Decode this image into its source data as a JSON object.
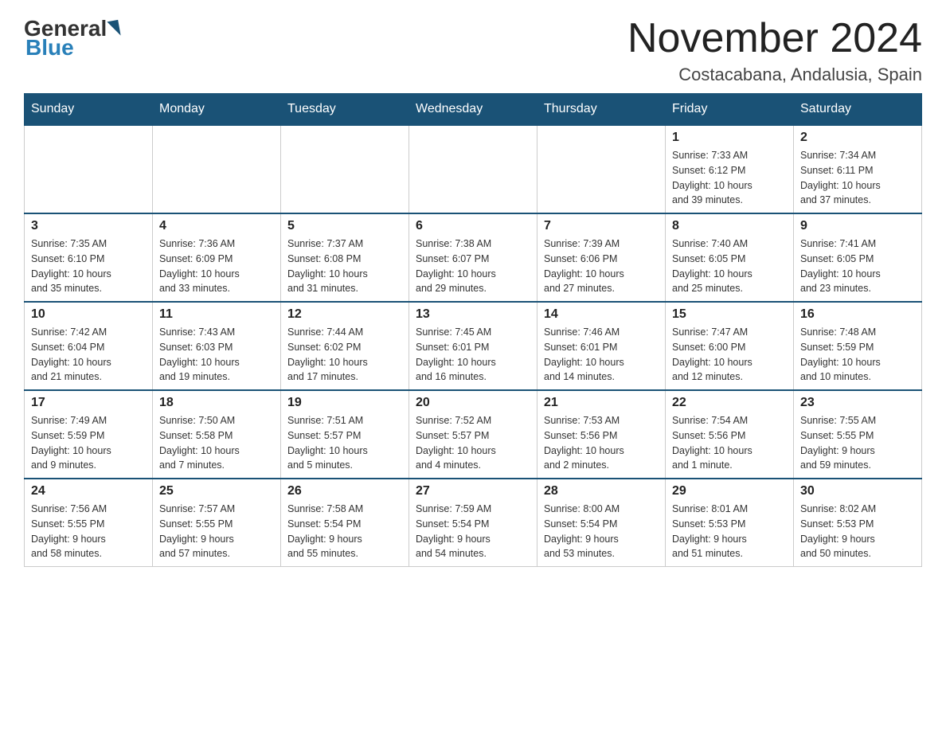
{
  "header": {
    "logo_general": "General",
    "logo_blue": "Blue",
    "title": "November 2024",
    "subtitle": "Costacabana, Andalusia, Spain"
  },
  "days_of_week": [
    "Sunday",
    "Monday",
    "Tuesday",
    "Wednesday",
    "Thursday",
    "Friday",
    "Saturday"
  ],
  "weeks": [
    {
      "days": [
        {
          "num": "",
          "info": ""
        },
        {
          "num": "",
          "info": ""
        },
        {
          "num": "",
          "info": ""
        },
        {
          "num": "",
          "info": ""
        },
        {
          "num": "",
          "info": ""
        },
        {
          "num": "1",
          "info": "Sunrise: 7:33 AM\nSunset: 6:12 PM\nDaylight: 10 hours\nand 39 minutes."
        },
        {
          "num": "2",
          "info": "Sunrise: 7:34 AM\nSunset: 6:11 PM\nDaylight: 10 hours\nand 37 minutes."
        }
      ]
    },
    {
      "days": [
        {
          "num": "3",
          "info": "Sunrise: 7:35 AM\nSunset: 6:10 PM\nDaylight: 10 hours\nand 35 minutes."
        },
        {
          "num": "4",
          "info": "Sunrise: 7:36 AM\nSunset: 6:09 PM\nDaylight: 10 hours\nand 33 minutes."
        },
        {
          "num": "5",
          "info": "Sunrise: 7:37 AM\nSunset: 6:08 PM\nDaylight: 10 hours\nand 31 minutes."
        },
        {
          "num": "6",
          "info": "Sunrise: 7:38 AM\nSunset: 6:07 PM\nDaylight: 10 hours\nand 29 minutes."
        },
        {
          "num": "7",
          "info": "Sunrise: 7:39 AM\nSunset: 6:06 PM\nDaylight: 10 hours\nand 27 minutes."
        },
        {
          "num": "8",
          "info": "Sunrise: 7:40 AM\nSunset: 6:05 PM\nDaylight: 10 hours\nand 25 minutes."
        },
        {
          "num": "9",
          "info": "Sunrise: 7:41 AM\nSunset: 6:05 PM\nDaylight: 10 hours\nand 23 minutes."
        }
      ]
    },
    {
      "days": [
        {
          "num": "10",
          "info": "Sunrise: 7:42 AM\nSunset: 6:04 PM\nDaylight: 10 hours\nand 21 minutes."
        },
        {
          "num": "11",
          "info": "Sunrise: 7:43 AM\nSunset: 6:03 PM\nDaylight: 10 hours\nand 19 minutes."
        },
        {
          "num": "12",
          "info": "Sunrise: 7:44 AM\nSunset: 6:02 PM\nDaylight: 10 hours\nand 17 minutes."
        },
        {
          "num": "13",
          "info": "Sunrise: 7:45 AM\nSunset: 6:01 PM\nDaylight: 10 hours\nand 16 minutes."
        },
        {
          "num": "14",
          "info": "Sunrise: 7:46 AM\nSunset: 6:01 PM\nDaylight: 10 hours\nand 14 minutes."
        },
        {
          "num": "15",
          "info": "Sunrise: 7:47 AM\nSunset: 6:00 PM\nDaylight: 10 hours\nand 12 minutes."
        },
        {
          "num": "16",
          "info": "Sunrise: 7:48 AM\nSunset: 5:59 PM\nDaylight: 10 hours\nand 10 minutes."
        }
      ]
    },
    {
      "days": [
        {
          "num": "17",
          "info": "Sunrise: 7:49 AM\nSunset: 5:59 PM\nDaylight: 10 hours\nand 9 minutes."
        },
        {
          "num": "18",
          "info": "Sunrise: 7:50 AM\nSunset: 5:58 PM\nDaylight: 10 hours\nand 7 minutes."
        },
        {
          "num": "19",
          "info": "Sunrise: 7:51 AM\nSunset: 5:57 PM\nDaylight: 10 hours\nand 5 minutes."
        },
        {
          "num": "20",
          "info": "Sunrise: 7:52 AM\nSunset: 5:57 PM\nDaylight: 10 hours\nand 4 minutes."
        },
        {
          "num": "21",
          "info": "Sunrise: 7:53 AM\nSunset: 5:56 PM\nDaylight: 10 hours\nand 2 minutes."
        },
        {
          "num": "22",
          "info": "Sunrise: 7:54 AM\nSunset: 5:56 PM\nDaylight: 10 hours\nand 1 minute."
        },
        {
          "num": "23",
          "info": "Sunrise: 7:55 AM\nSunset: 5:55 PM\nDaylight: 9 hours\nand 59 minutes."
        }
      ]
    },
    {
      "days": [
        {
          "num": "24",
          "info": "Sunrise: 7:56 AM\nSunset: 5:55 PM\nDaylight: 9 hours\nand 58 minutes."
        },
        {
          "num": "25",
          "info": "Sunrise: 7:57 AM\nSunset: 5:55 PM\nDaylight: 9 hours\nand 57 minutes."
        },
        {
          "num": "26",
          "info": "Sunrise: 7:58 AM\nSunset: 5:54 PM\nDaylight: 9 hours\nand 55 minutes."
        },
        {
          "num": "27",
          "info": "Sunrise: 7:59 AM\nSunset: 5:54 PM\nDaylight: 9 hours\nand 54 minutes."
        },
        {
          "num": "28",
          "info": "Sunrise: 8:00 AM\nSunset: 5:54 PM\nDaylight: 9 hours\nand 53 minutes."
        },
        {
          "num": "29",
          "info": "Sunrise: 8:01 AM\nSunset: 5:53 PM\nDaylight: 9 hours\nand 51 minutes."
        },
        {
          "num": "30",
          "info": "Sunrise: 8:02 AM\nSunset: 5:53 PM\nDaylight: 9 hours\nand 50 minutes."
        }
      ]
    }
  ]
}
